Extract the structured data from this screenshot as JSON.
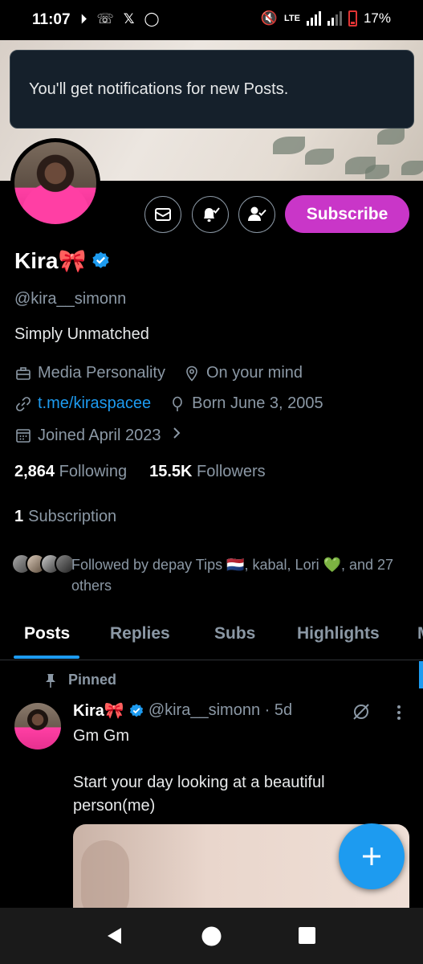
{
  "status_bar": {
    "time": "11:07",
    "network": "LTE",
    "battery": "17%"
  },
  "toast": {
    "message": "You'll get notifications for new Posts."
  },
  "profile": {
    "name": "Kira🎀",
    "handle": "@kira__simonn",
    "bio": "Simply Unmatched",
    "category": "Media Personality",
    "location": "On your mind",
    "website": "t.me/kiraspacee",
    "birthday": "Born June 3, 2005",
    "joined": "Joined April 2023",
    "following_count": "2,864",
    "following_label": "Following",
    "followers_count": "15.5K",
    "followers_label": "Followers",
    "subscription_count": "1",
    "subscription_label": "Subscription",
    "followed_by": "Followed by depay Tips 🇳🇱, kabal, Lori 💚, and 27 others"
  },
  "actions": {
    "subscribe_label": "Subscribe",
    "message_icon": "envelope-icon",
    "notify_icon": "bell-check-icon",
    "follow_icon": "person-check-icon"
  },
  "tabs": [
    {
      "label": "Posts",
      "active": true
    },
    {
      "label": "Replies",
      "active": false
    },
    {
      "label": "Subs",
      "active": false
    },
    {
      "label": "Highlights",
      "active": false
    },
    {
      "label": "M",
      "active": false
    }
  ],
  "post": {
    "pinned_label": "Pinned",
    "author_name": "Kira🎀",
    "author_meta": "@kira__simonn · 5d",
    "line1": "Gm Gm",
    "line2": "Start your day looking at a beautiful",
    "line3": "person(me)"
  },
  "colors": {
    "accent": "#1d9bf0",
    "subscribe": "#c936c8",
    "background": "#000000",
    "muted_text": "#8b98a5"
  }
}
